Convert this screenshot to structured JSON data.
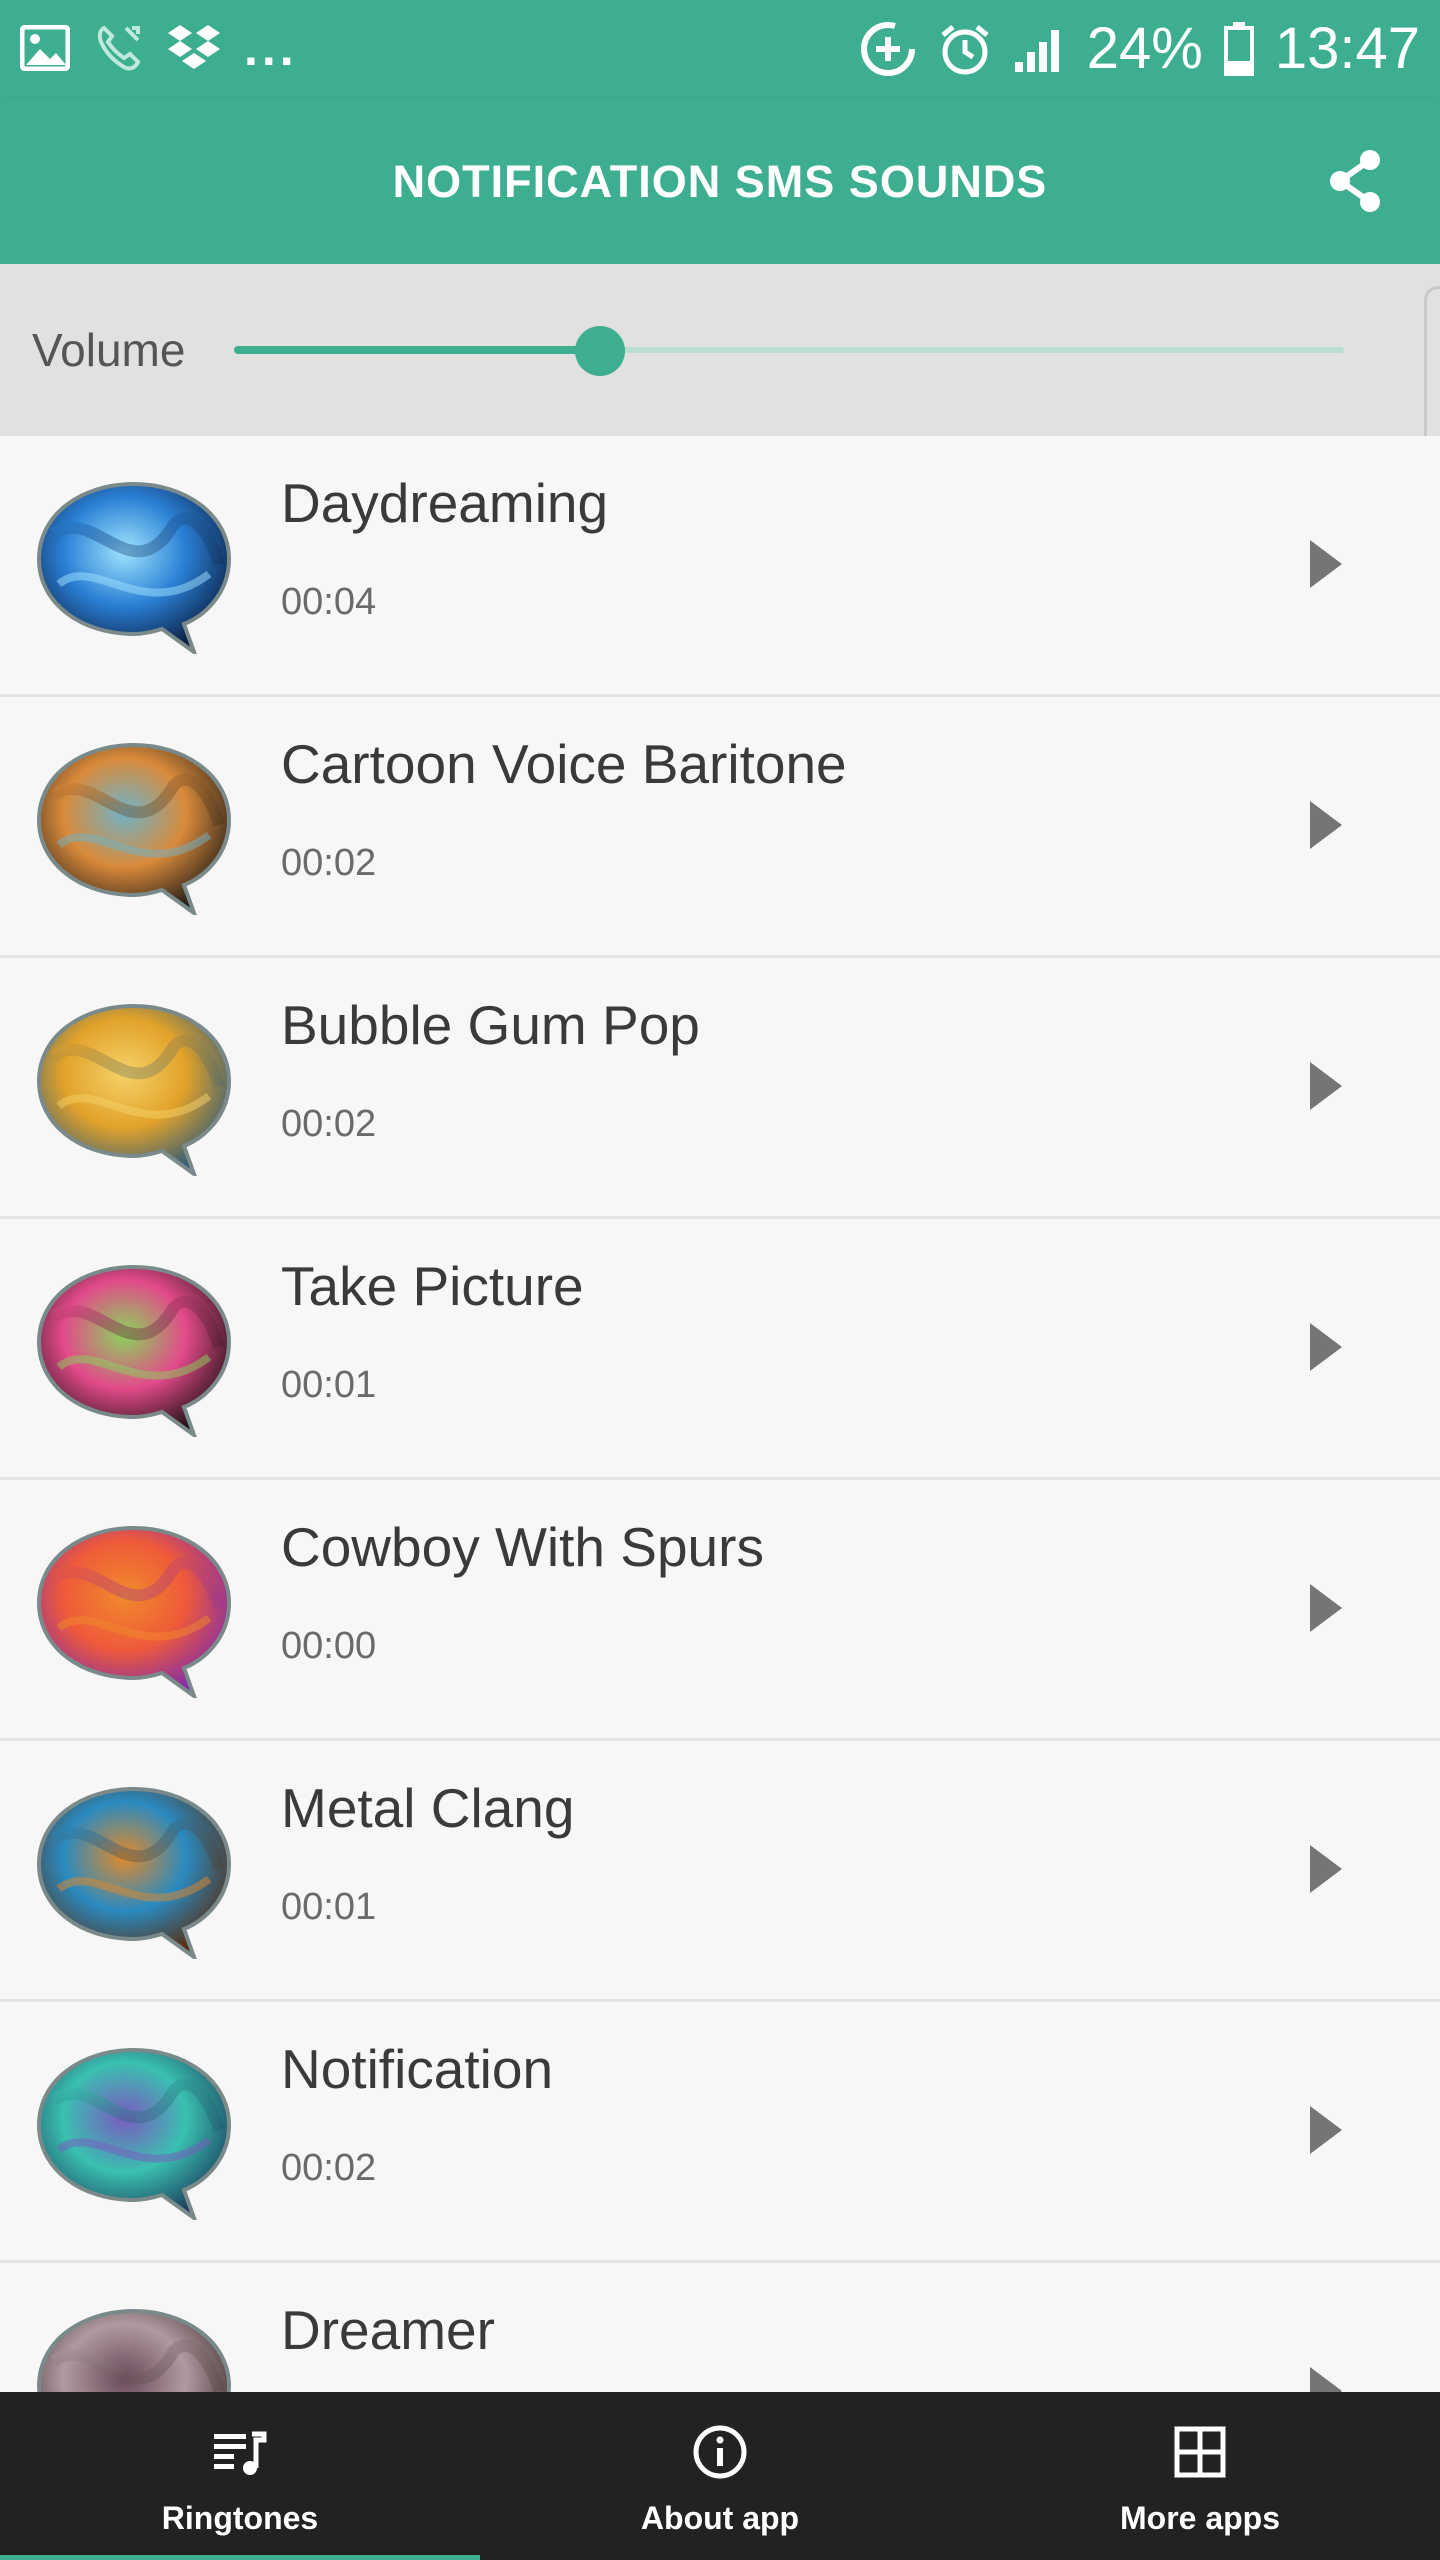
{
  "status_bar": {
    "dots": "...",
    "battery": "24%",
    "time": "13:47"
  },
  "app_bar": {
    "title": "NOTIFICATION SMS SOUNDS",
    "share_icon": "share-icon"
  },
  "volume": {
    "label": "Volume",
    "level_percent": 33
  },
  "sounds": [
    {
      "title": "Daydreaming",
      "duration": "00:04",
      "colors": [
        "#0a1a3a",
        "#2a7fd4",
        "#9fe4ff"
      ]
    },
    {
      "title": "Cartoon Voice Baritone",
      "duration": "00:02",
      "colors": [
        "#1d1a17",
        "#d98a3a",
        "#6fb3c8"
      ]
    },
    {
      "title": "Bubble Gum Pop",
      "duration": "00:02",
      "colors": [
        "#2a5a7a",
        "#e2a22a",
        "#f5d26a"
      ]
    },
    {
      "title": "Take Picture",
      "duration": "00:01",
      "colors": [
        "#1a1010",
        "#e24a8a",
        "#8ad45a"
      ]
    },
    {
      "title": "Cowboy With Spurs",
      "duration": "00:00",
      "colors": [
        "#7a2ab0",
        "#ef5a3a",
        "#f08a2a"
      ]
    },
    {
      "title": "Metal Clang",
      "duration": "00:01",
      "colors": [
        "#5a2a0a",
        "#2a8ac0",
        "#e28a2a"
      ]
    },
    {
      "title": "Notification",
      "duration": "00:02",
      "colors": [
        "#1a3a5a",
        "#3ac0b0",
        "#7a5ac0"
      ]
    },
    {
      "title": "Dreamer",
      "duration": "",
      "colors": [
        "#3a2a2a",
        "#b09aa0",
        "#6a4a5a"
      ]
    }
  ],
  "bottom_nav": [
    {
      "label": "Ringtones",
      "icon": "playlist-music-icon",
      "active": true
    },
    {
      "label": "About app",
      "icon": "info-icon",
      "active": false
    },
    {
      "label": "More apps",
      "icon": "grid-icon",
      "active": false
    }
  ]
}
